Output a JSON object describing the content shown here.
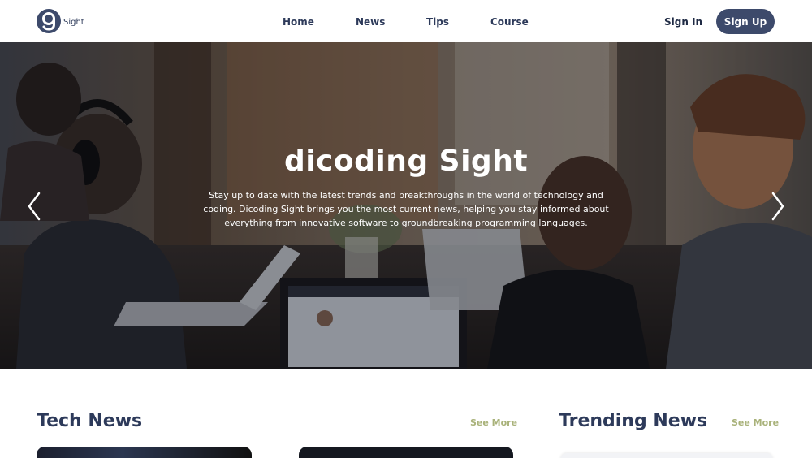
{
  "brand": {
    "logo_text": "Sight"
  },
  "nav": {
    "home": "Home",
    "news": "News",
    "tips": "Tips",
    "course": "Course",
    "sign_in": "Sign In",
    "sign_up": "Sign Up"
  },
  "hero": {
    "title": "dicoding Sight",
    "description": "Stay up to date with the latest trends and breakthroughs in the world of technology and coding. Dicoding Sight brings you the most current news, helping you stay informed about everything from innovative software to groundbreaking programming languages.",
    "prev_icon": "chevron-left-icon",
    "next_icon": "chevron-right-icon"
  },
  "sections": {
    "tech": {
      "title": "Tech News",
      "see_more": "See More"
    },
    "trending": {
      "title": "Trending News",
      "see_more": "See More"
    }
  },
  "colors": {
    "primary": "#3d4a6b",
    "heading": "#2d3a5a",
    "accent": "#a9b27a"
  }
}
